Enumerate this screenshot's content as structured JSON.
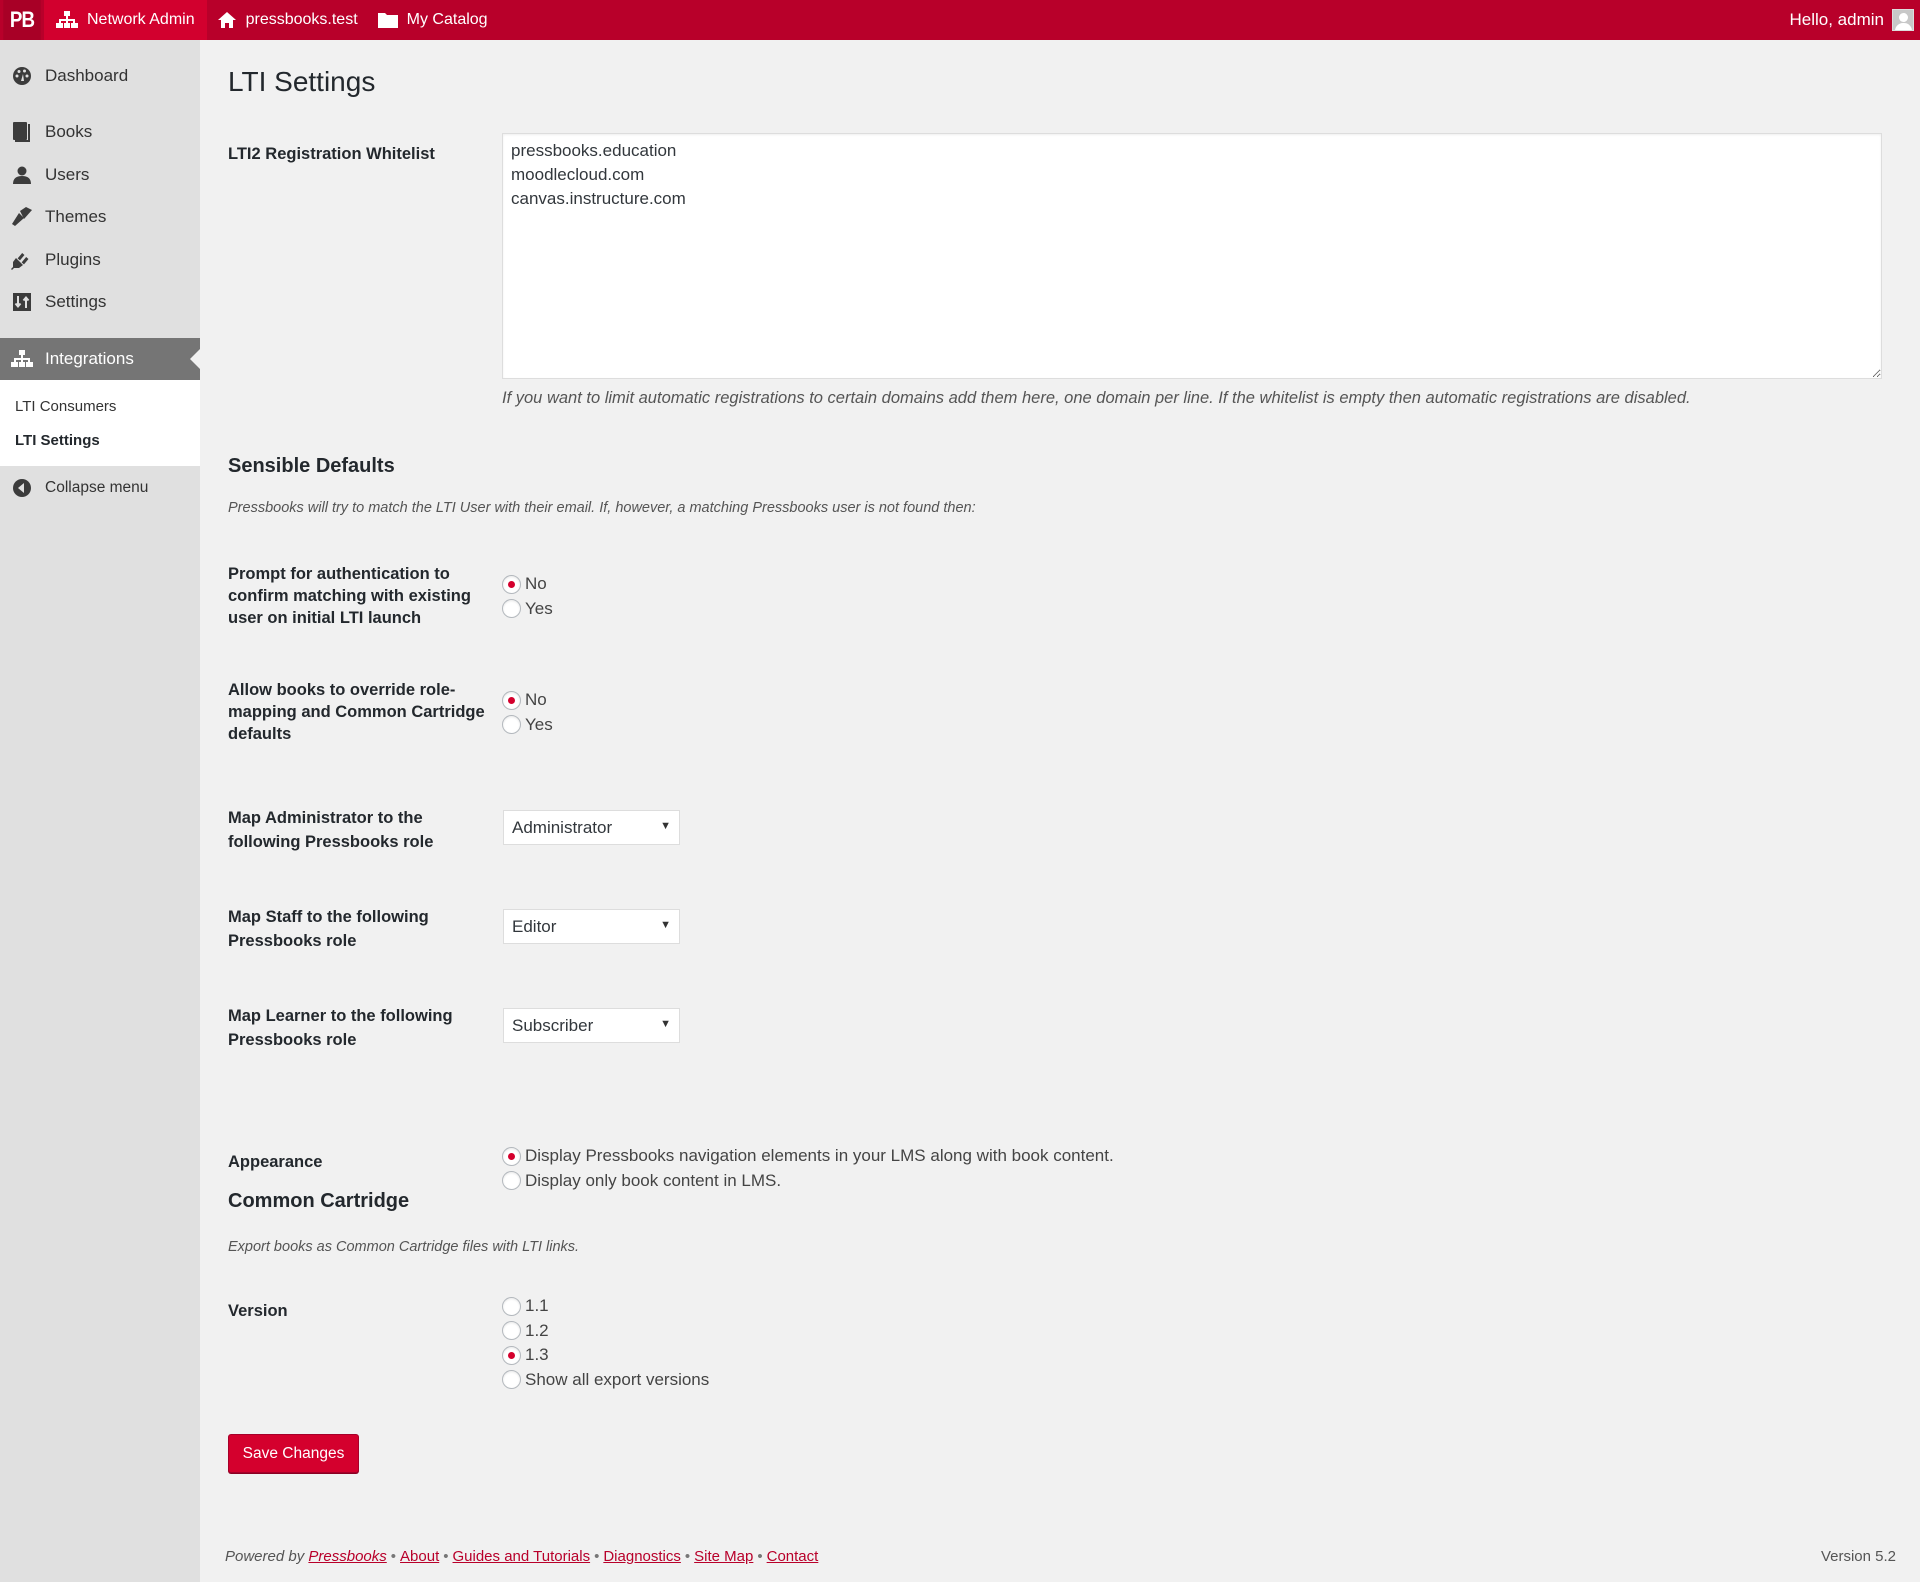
{
  "adminbar": {
    "logo": "PB",
    "network_admin": "Network Admin",
    "site": "pressbooks.test",
    "catalog": "My Catalog",
    "greeting": "Hello, admin",
    "icons": {
      "network": "sitemap-icon",
      "site": "home-icon",
      "catalog": "folder-icon",
      "avatar": "avatar-icon"
    }
  },
  "sidebar": {
    "items": [
      {
        "label": "Dashboard",
        "icon": "dashboard-icon"
      },
      {
        "label": "Books",
        "icon": "book-icon"
      },
      {
        "label": "Users",
        "icon": "user-icon"
      },
      {
        "label": "Themes",
        "icon": "brush-icon"
      },
      {
        "label": "Plugins",
        "icon": "plug-icon"
      },
      {
        "label": "Settings",
        "icon": "settings-icon"
      },
      {
        "label": "Integrations",
        "icon": "sitemap-icon",
        "current": true
      }
    ],
    "submenu": [
      {
        "label": "LTI Consumers",
        "active": false
      },
      {
        "label": "LTI Settings",
        "active": true
      }
    ],
    "collapse": "Collapse menu"
  },
  "page": {
    "title": "LTI Settings",
    "whitelist": {
      "label": "LTI2 Registration Whitelist",
      "value": "pressbooks.education\nmoodlecloud.com\ncanvas.instructure.com",
      "description": "If you want to limit automatic registrations to certain domains add them here, one domain per line. If the whitelist is empty then automatic registrations are disabled."
    },
    "sensible_defaults": {
      "heading": "Sensible Defaults",
      "description": "Pressbooks will try to match the LTI User with their email. If, however, a matching Pressbooks user is not found then:",
      "prompt_auth": {
        "label": "Prompt for authentication to confirm matching with existing user on initial LTI launch",
        "options": [
          {
            "label": "No",
            "checked": true
          },
          {
            "label": "Yes",
            "checked": false
          }
        ]
      },
      "allow_override": {
        "label": "Allow books to override role-mapping and Common Cartridge defaults",
        "options": [
          {
            "label": "No",
            "checked": true
          },
          {
            "label": "Yes",
            "checked": false
          }
        ]
      },
      "map_admin": {
        "label": "Map Administrator to the following Pressbooks role",
        "selected": "Administrator"
      },
      "map_staff": {
        "label": "Map Staff to the following Pressbooks role",
        "selected": "Editor"
      },
      "map_learner": {
        "label": "Map Learner to the following Pressbooks role",
        "selected": "Subscriber"
      },
      "appearance": {
        "label": "Appearance",
        "options": [
          {
            "label": "Display Pressbooks navigation elements in your LMS along with book content.",
            "checked": true
          },
          {
            "label": "Display only book content in LMS.",
            "checked": false
          }
        ]
      }
    },
    "common_cartridge": {
      "heading": "Common Cartridge",
      "description": "Export books as Common Cartridge files with LTI links.",
      "version": {
        "label": "Version",
        "options": [
          {
            "label": "1.1",
            "checked": false
          },
          {
            "label": "1.2",
            "checked": false
          },
          {
            "label": "1.3",
            "checked": true
          },
          {
            "label": "Show all export versions",
            "checked": false
          }
        ]
      }
    },
    "save_label": "Save Changes"
  },
  "footer": {
    "powered_by": "Powered by",
    "links": [
      "Pressbooks",
      "About",
      "Guides and Tutorials",
      "Diagnostics",
      "Site Map",
      "Contact"
    ],
    "separator": "•",
    "version": "Version 5.2"
  },
  "colors": {
    "brand": "#b8002a",
    "accent": "#d4002d",
    "sidebar_current": "#757575"
  }
}
